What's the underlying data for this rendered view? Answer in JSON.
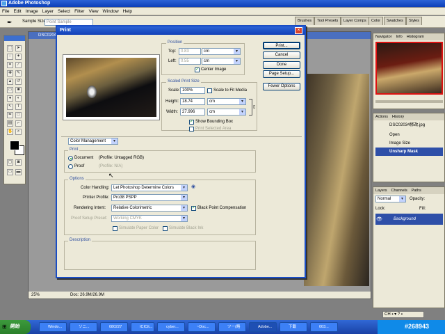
{
  "app": {
    "title": "Adobe Photoshop"
  },
  "menu": [
    "File",
    "Edit",
    "Image",
    "Layer",
    "Select",
    "Filter",
    "View",
    "Window",
    "Help"
  ],
  "options_bar": {
    "sample_size_label": "Sample Size:",
    "sample_size_value": "Point Sample"
  },
  "palette_well": [
    "Brushes",
    "Tool Presets",
    "Layer Comps",
    "Color",
    "Swatches",
    "Styles"
  ],
  "document": {
    "title": "DSC0204...",
    "zoom": "25%",
    "doc_size": "Doc: 26.9M/26.9M"
  },
  "navigator": {
    "tabs": [
      "Navigator",
      "Info",
      "Histogram"
    ]
  },
  "history": {
    "tabs": [
      "Actions",
      "History"
    ],
    "snapshot": "DSC02034修改.jpg",
    "items": [
      "Open",
      "Image Size",
      "Unsharp Mask"
    ]
  },
  "layers": {
    "tabs": [
      "Layers",
      "Channels",
      "Paths"
    ],
    "blend_mode": "Normal",
    "opacity_label": "Opacity:",
    "lock_label": "Lock:",
    "fill_label": "Fill:",
    "layer_name": "Background"
  },
  "print_dialog": {
    "title": "Print",
    "position": {
      "label": "Position",
      "top_label": "Top:",
      "top_value": "0.83",
      "top_unit": "cm",
      "left_label": "Left:",
      "left_value": "0.55",
      "left_unit": "cm",
      "center_image": "Center Image"
    },
    "scaled": {
      "label": "Scaled Print Size",
      "scale_label": "Scale:",
      "scale_value": "100%",
      "fit_media": "Scale to Fit Media",
      "height_label": "Height:",
      "height_value": "18.74",
      "height_unit": "cm",
      "width_label": "Width:",
      "width_value": "27.996",
      "width_unit": "cm",
      "show_bbox": "Show Bounding Box",
      "print_selected": "Print Selected Area"
    },
    "buttons": [
      "Print...",
      "Cancel",
      "Done",
      "Page Setup...",
      "Fewer Options"
    ],
    "color_mgmt": "Color Management",
    "print_group": {
      "label": "Print",
      "document": "Document",
      "document_profile": "(Profile: Untagged RGB)",
      "proof": "Proof",
      "proof_profile": "(Profile: N/A)"
    },
    "options": {
      "label": "Options",
      "color_handling_label": "Color Handling:",
      "color_handling": "Let Photoshop Determine Colors",
      "printer_profile_label": "Printer Profile:",
      "printer_profile": "Pro38 PSPP",
      "rendering_label": "Rendering Intent:",
      "rendering": "Relative Colorimetric",
      "bpc": "Black Point Compensation",
      "proof_preset_label": "Proof Setup Preset:",
      "proof_preset": "Working CMYK",
      "sim_paper": "Simulate Paper Color",
      "sim_ink": "Simulate Black Ink"
    },
    "description_label": "Description"
  },
  "taskbar": {
    "start": "開始",
    "tasks": [
      "Windo...",
      "ソニ...",
      "080227",
      "ICICit...",
      "cyber...",
      "~Doc...",
      "ツー(略",
      "Adobe...",
      "下載",
      "003..."
    ],
    "time": "5:04"
  },
  "watermark": "#268943"
}
